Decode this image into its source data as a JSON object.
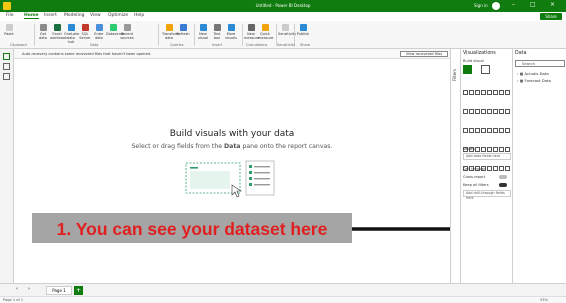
{
  "window": {
    "title": "Untitled - Power BI Desktop",
    "signin": "Sign in",
    "share": "Share"
  },
  "menu": [
    "File",
    "Home",
    "Insert",
    "Modeling",
    "View",
    "Optimize",
    "Help"
  ],
  "ribbon": {
    "buttons": [
      "Paste",
      "Get data",
      "Excel workbook",
      "OneLake data hub",
      "SQL Server",
      "Enter data",
      "Dataverse",
      "Recent sources",
      "Transform data",
      "Refresh",
      "New visual",
      "Text box",
      "More visuals",
      "New measure",
      "Quick measure",
      "Sensitivity",
      "Publish"
    ],
    "groups": [
      "Clipboard",
      "Data",
      "Queries",
      "Insert",
      "Calculations",
      "Sensitivity",
      "Share"
    ]
  },
  "notification": {
    "text": "Auto recovery contains some recovered files that haven't been opened.",
    "button": "View recovered files"
  },
  "canvas": {
    "heading": "Build visuals with your data",
    "sub_prefix": "Select or drag fields from the ",
    "sub_bold": "Data",
    "sub_suffix": " pane onto the report canvas."
  },
  "callout": "1. You can see your dataset here",
  "filters_label": "Filters",
  "visualizations": {
    "title": "Visualizations",
    "build_visual": "Build visual",
    "values_label": "Values",
    "values_field": "Add data fields here",
    "drillthrough": "Drill through",
    "cross_report": "Cross-report",
    "keep_filters": "Keep all filters",
    "drill_field": "Add drill-through fields here"
  },
  "data": {
    "title": "Data",
    "search_placeholder": "Search",
    "tables": [
      "Actuals Data",
      "Forecast Data"
    ]
  },
  "pages": {
    "page1": "Page 1",
    "add": "+"
  },
  "status": {
    "page": "Page 1 of 1",
    "zoom": "53%"
  },
  "colors": {
    "brand": "#107c10",
    "callout_text": "#e02020",
    "callout_bg": "#a5a5a5"
  }
}
